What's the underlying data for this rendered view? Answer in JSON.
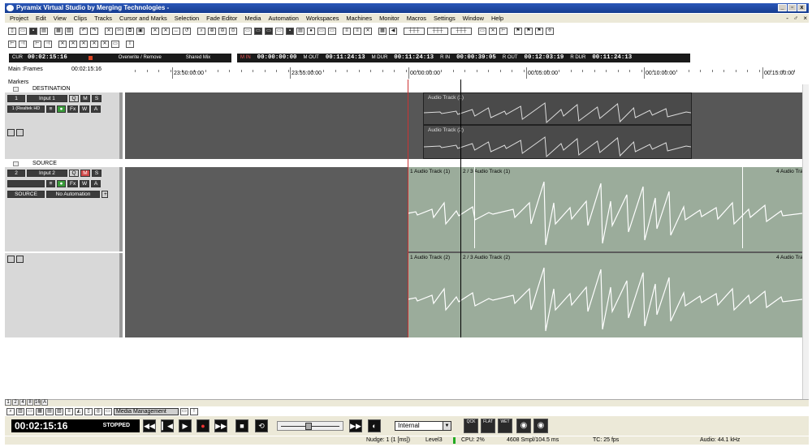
{
  "title": "Pyramix Virtual Studio by Merging Technologies -",
  "window_controls": [
    "_",
    "▫",
    "x"
  ],
  "menu": [
    "Project",
    "Edit",
    "View",
    "Clips",
    "Tracks",
    "Cursor and Marks",
    "Selection",
    "Fade Editor",
    "Media",
    "Automation",
    "Workspaces",
    "Machines",
    "Monitor",
    "Macros",
    "Settings",
    "Window",
    "Help"
  ],
  "menu_right": "- ♂ ×",
  "timecodes": {
    "cur_label": "CUR",
    "cur_value": "00:02:15:16",
    "overwrite": "Overwrite / Remove",
    "shared": "Shared Mix",
    "min_label": "M IN",
    "min_value": "00:00:00:00",
    "mout_label": "M OUT",
    "mout_value": "00:11:24:13",
    "mdur_label": "M DUR",
    "mdur_value": "00:11:24:13",
    "rin_label": "R IN",
    "rin_value": "00:00:39:05",
    "rout_label": "R OUT",
    "rout_value": "00:12:03:19",
    "rdur_label": "R DUR",
    "rdur_value": "00:11:24:13"
  },
  "ruler": {
    "main_label": "Main :Frames",
    "main_value": "00:02:15:16",
    "ticks": [
      "23:50:00:00",
      "23:55:00:00",
      "00:00:00:00",
      "00:05:00:00",
      "00:10:00:00",
      "00:15:00:00"
    ]
  },
  "markers_label": "Markers",
  "groups": {
    "destination": "DESTINATION",
    "source": "SOURCE"
  },
  "tracks": {
    "t1": {
      "num": "1",
      "input": "Input 1",
      "device": "1 (Realtek HD",
      "q": "Q",
      "m": "M",
      "s": "S",
      "fx": "Fx",
      "w": "W",
      "a": "A"
    },
    "t2": {
      "num": "2",
      "input": "Input 2",
      "src": "SOURCE",
      "auto": "No Automation",
      "q": "Q",
      "m": "M",
      "s": "S",
      "fx": "Fx",
      "w": "W",
      "a": "A"
    }
  },
  "clips": {
    "dest1": "Audio Track (1)",
    "dest2": "Audio Track (2)",
    "src1a": "1 Audio Track (1)",
    "src1b": "2 / 3 Audio Track (1)",
    "src1c": "4 Audio Tra",
    "src2a": "1 Audio Track (2)",
    "src2b": "2 / 3 Audio Track (2)",
    "src2c": "4 Audio Tra"
  },
  "zoom_buttons": [
    "1",
    "2",
    "4",
    "8",
    "16",
    "A"
  ],
  "media_management": "Media Management",
  "transport": {
    "timecode": "00:02:15:16",
    "state": "STOPPED",
    "sync": "Internal",
    "mode_buttons": [
      "QCK",
      "FLAT",
      "WET"
    ]
  },
  "status": {
    "nudge": "Nudge: 1 (1 [ms])",
    "level": "Level3",
    "cpu": "CPU: 2%",
    "smpl": "4608 Smpl/104.5 ms",
    "tc": "TC: 25 fps",
    "audio": "Audio: 44.1 kHz"
  },
  "colors": {
    "clip_green": "#9bac9b",
    "track_dark": "#575757",
    "playhead": "#000000",
    "record": "#d04848"
  }
}
